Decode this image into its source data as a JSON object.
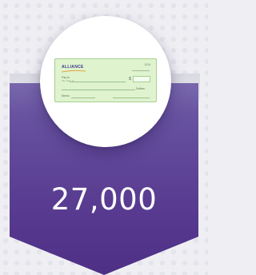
{
  "stat": {
    "value": "27,000"
  },
  "check": {
    "brand_name": "ALLIANCE",
    "check_number": "1026",
    "pay_label": "Pay to",
    "pay_sublabel": "the order of",
    "currency_symbol": "$",
    "dollars_label": "Dollars",
    "memo_label": "Memo"
  },
  "colors": {
    "banner_top": "#6d5ba6",
    "banner_bottom": "#4e2f86",
    "check_fill": "#dff3cf",
    "check_border": "#a7cf90",
    "background": "#efeff3"
  },
  "icons": {
    "illustration": "check-icon"
  }
}
